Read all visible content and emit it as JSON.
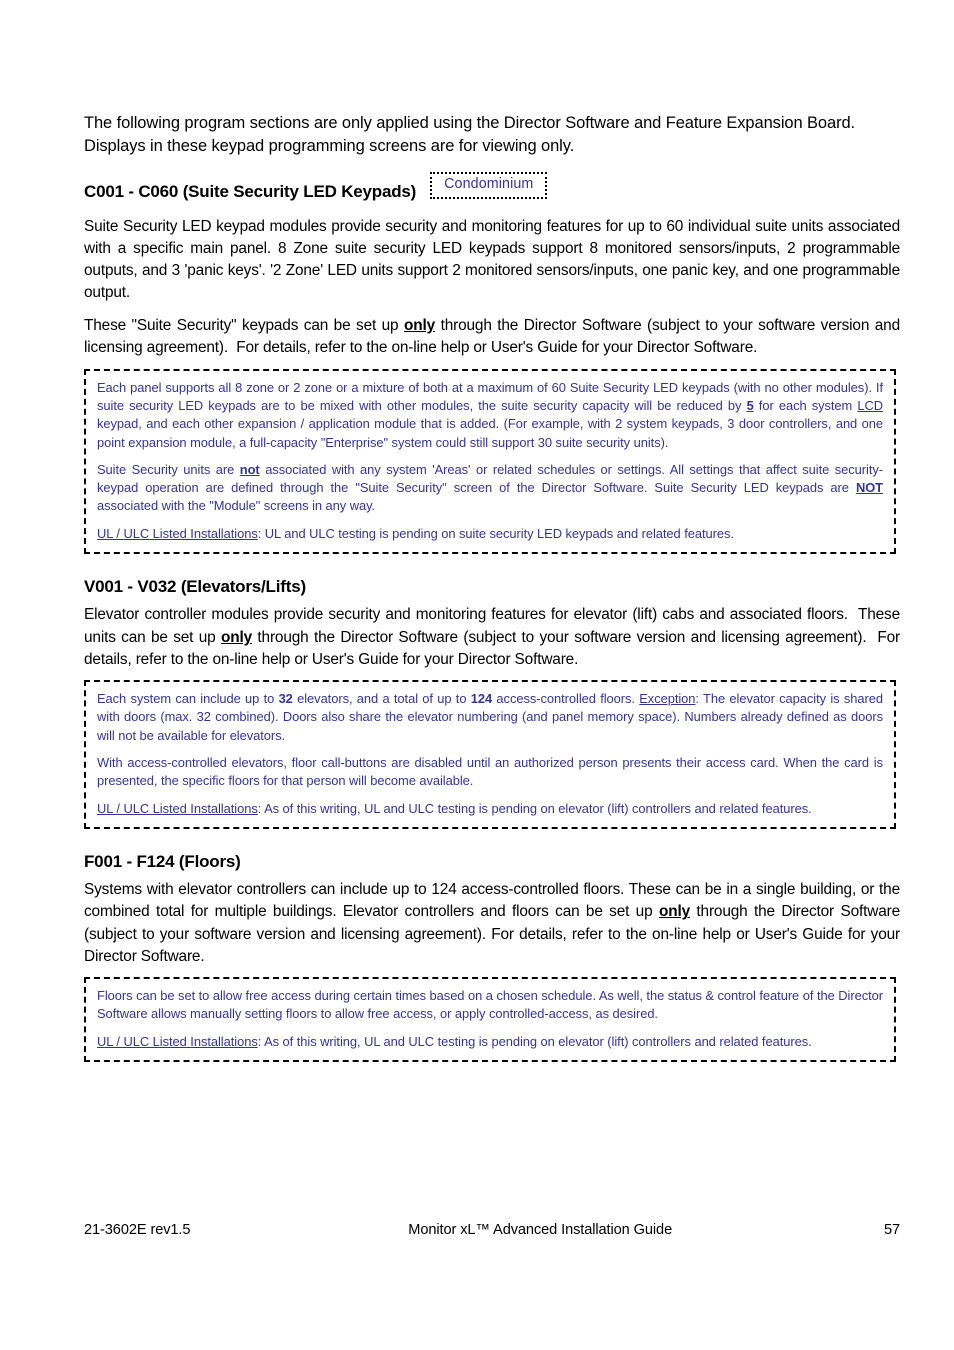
{
  "document": {
    "intro": "The following program sections are only applied using the Director Software and Feature Expansion Board. Displays in these keypad programming screens are for viewing only."
  },
  "colors": {
    "note_text_blue": "#3333a0",
    "body_text": "#000000",
    "border": "#000000"
  },
  "sections": [
    {
      "id": "c001-c060",
      "heading": "C001 - C060  (Suite Security LED Keypads)",
      "tag": "Condominium",
      "paragraphs": [
        "Suite Security LED keypad modules provide security and monitoring features for up to 60 individual suite units associated with a specific main panel.  8 Zone suite security LED keypads support 8 monitored sensors/inputs, 2 programmable outputs, and 3 'panic keys'.  '2 Zone' LED units support 2 monitored sensors/inputs, one panic key, and one programmable output.",
        "These \"Suite Security\" keypads can be set up only through the Director Software (subject to your software version and licensing agreement).  For details, refer to the on-line help or User's Guide for your Director Software."
      ],
      "note": {
        "p1_a": "Each panel supports all 8 zone or 2 zone or a mixture of both at a maximum of 60 Suite Security LED keypads (with no other modules).  If suite security LED keypads are to be mixed with other modules, the suite security capacity will be reduced by ",
        "p1_b": "5",
        "p1_c": " for each system ",
        "p1_d": "LCD",
        "p1_e": " keypad, and each other expansion / application module that is added.  (For example, with 2 system keypads, 3 door controllers, and one point expansion module, a full-capacity \"Enterprise\" system could still support 30 suite security units).",
        "p2_a": "Suite Security units are ",
        "p2_b": "not",
        "p2_c": " associated with any system 'Areas' or related schedules or settings.  All settings that affect suite security-keypad operation are defined through the \"Suite Security\" screen of the Director Software.  Suite Security LED keypads are ",
        "p2_d": "NOT",
        "p2_e": " associated with the \"Module\" screens in any way.",
        "ul_label": "UL / ULC Listed Installations",
        "ul_text": ":  UL and ULC testing is pending on suite security LED keypads and related features."
      }
    },
    {
      "id": "v001-v032",
      "heading": "V001 - V032 (Elevators/Lifts)",
      "tag": null,
      "paragraphs": [
        "Elevator controller modules provide security and monitoring features for elevator (lift) cabs and associated floors.  These units can be set up only through the Director Software (subject to your software version and licensing agreement).  For details, refer to the on-line help or User's Guide for your Director Software."
      ],
      "note": {
        "p1_a": "Each system can include up to ",
        "p1_b": "32",
        "p1_c": " elevators, and a total of up to ",
        "p1_d": "124",
        "p1_e": " access-controlled floors.  ",
        "p1_f": "Exception",
        "p1_g": ":  The elevator capacity is shared with doors (max. 32 combined).   Doors also share the elevator numbering (and panel memory space).   Numbers already defined as doors will not be available for elevators.",
        "p2": "With access-controlled elevators, floor call-buttons are disabled until an authorized person presents their access card.  When the card is presented, the specific floors for that person will become available.",
        "ul_label": "UL / ULC Listed Installations",
        "ul_text": ":  As of this writing, UL and ULC testing is pending on elevator (lift) controllers and related features."
      }
    },
    {
      "id": "f001-f124",
      "heading": "F001 - F124 (Floors)",
      "tag": null,
      "paragraphs": [
        "Systems with elevator controllers can include up to 124 access-controlled floors. These can be in a single building, or the combined total for multiple buildings. Elevator controllers and floors can be set up only through the Director Software (subject to your software version and licensing agreement). For details, refer to the on-line help or User's Guide for your Director Software."
      ],
      "note": {
        "p1": "Floors can be set to allow free access during certain times based on a chosen schedule.  As well, the status & control feature of the Director Software allows manually setting floors to allow free access, or apply controlled-access, as desired.",
        "ul_label": "UL / ULC Listed Installations",
        "ul_text": ":  As of this writing, UL and ULC testing is pending on elevator (lift) controllers and related features."
      }
    }
  ],
  "inline_emphasis": {
    "only": "only",
    "not": "not",
    "NOT": "NOT"
  },
  "footer": {
    "doc_number": "21-3602E rev1.5",
    "title": "Monitor xL™ Advanced Installation Guide",
    "page_number": "57"
  }
}
